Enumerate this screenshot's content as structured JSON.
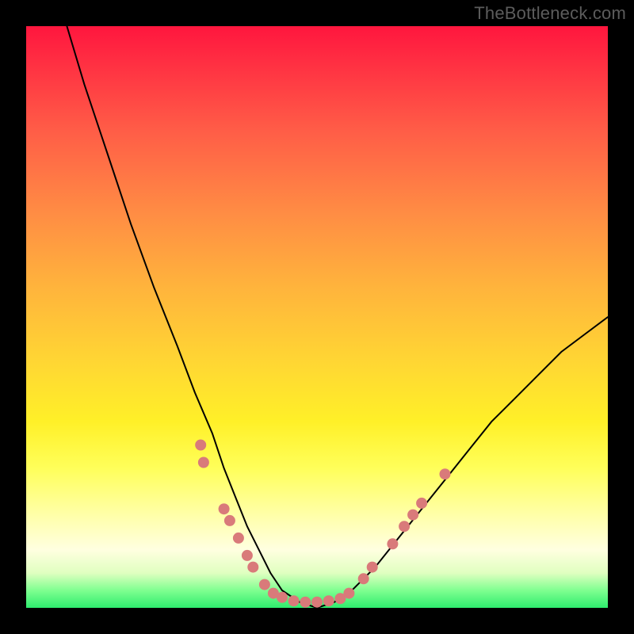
{
  "watermark": "TheBottleneck.com",
  "chart_data": {
    "type": "line",
    "title": "",
    "xlabel": "",
    "ylabel": "",
    "xlim": [
      0,
      100
    ],
    "ylim": [
      0,
      100
    ],
    "grid": false,
    "series": [
      {
        "name": "curve",
        "color": "#000000",
        "x": [
          7,
          10,
          14,
          18,
          22,
          26,
          29,
          32,
          34,
          36,
          38,
          40,
          42,
          44,
          47,
          50,
          53,
          56,
          60,
          64,
          68,
          72,
          76,
          80,
          84,
          88,
          92,
          96,
          100
        ],
        "y": [
          100,
          90,
          78,
          66,
          55,
          45,
          37,
          30,
          24,
          19,
          14,
          10,
          6,
          3,
          1,
          0,
          1,
          3,
          7,
          12,
          17,
          22,
          27,
          32,
          36,
          40,
          44,
          47,
          50
        ]
      }
    ],
    "markers": [
      {
        "name": "dots",
        "color": "#d97a7a",
        "radius_px": 7,
        "points": [
          {
            "x": 30,
            "y": 28
          },
          {
            "x": 30.5,
            "y": 25
          },
          {
            "x": 34,
            "y": 17
          },
          {
            "x": 35,
            "y": 15
          },
          {
            "x": 36.5,
            "y": 12
          },
          {
            "x": 38,
            "y": 9
          },
          {
            "x": 39,
            "y": 7
          },
          {
            "x": 41,
            "y": 4
          },
          {
            "x": 42.5,
            "y": 2.5
          },
          {
            "x": 44,
            "y": 1.8
          },
          {
            "x": 46,
            "y": 1.2
          },
          {
            "x": 48,
            "y": 1
          },
          {
            "x": 50,
            "y": 1
          },
          {
            "x": 52,
            "y": 1.2
          },
          {
            "x": 54,
            "y": 1.6
          },
          {
            "x": 55.5,
            "y": 2.5
          },
          {
            "x": 58,
            "y": 5
          },
          {
            "x": 59.5,
            "y": 7
          },
          {
            "x": 63,
            "y": 11
          },
          {
            "x": 65,
            "y": 14
          },
          {
            "x": 66.5,
            "y": 16
          },
          {
            "x": 68,
            "y": 18
          },
          {
            "x": 72,
            "y": 23
          }
        ]
      }
    ]
  }
}
